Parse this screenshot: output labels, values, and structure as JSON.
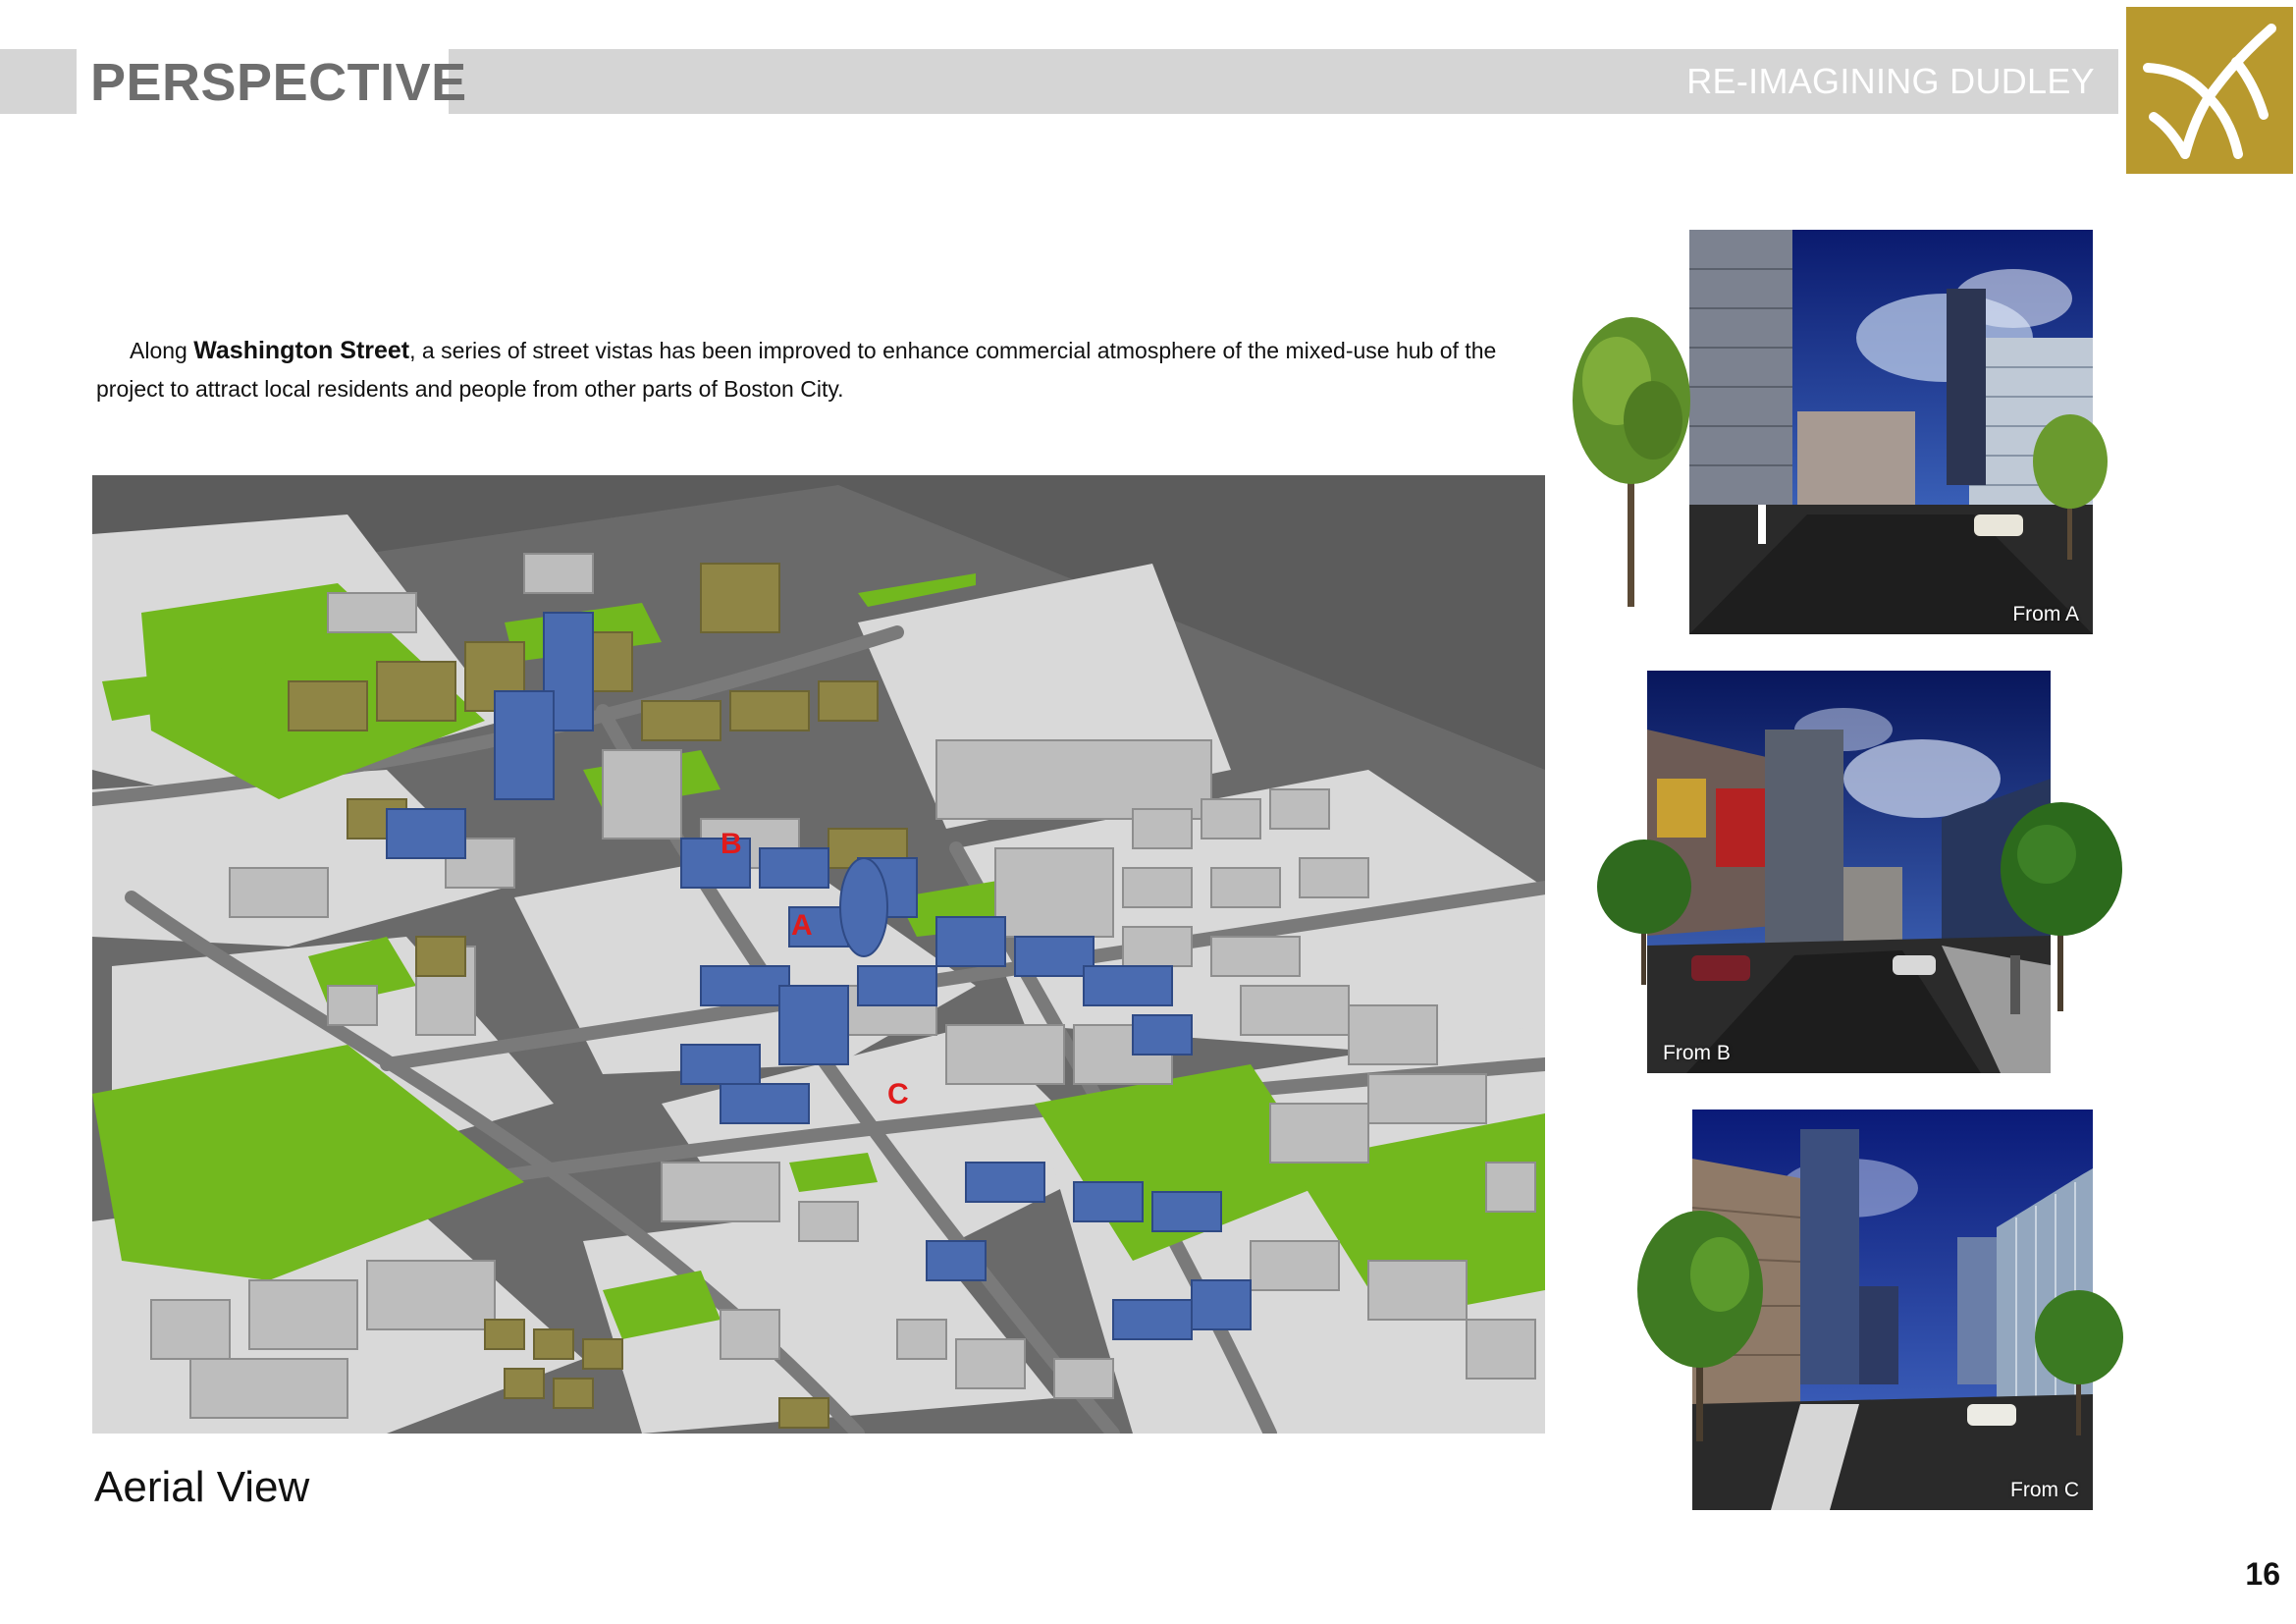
{
  "header": {
    "section_title": "PERSPECTIVE",
    "project_title": "RE-IMAGINING DUDLEY",
    "logo_icon": "dudley-intersection-logo-icon"
  },
  "intro": {
    "lead": "Along ",
    "street": "Washington Street",
    "rest": ", a series of street vistas has been improved to enhance commercial atmosphere of the mixed-use hub of the project to attract local residents and people from other parts of Boston City."
  },
  "aerial": {
    "caption": "Aerial View",
    "markers": [
      "B",
      "A",
      "C"
    ]
  },
  "views": [
    {
      "label": "From A"
    },
    {
      "label": "From B"
    },
    {
      "label": "From C"
    }
  ],
  "page_number": "16",
  "colors": {
    "header_band": "#d5d5d5",
    "section_title": "#6e6e6e",
    "logo_bg": "#b8992e",
    "proposed_building": "#4a6bb0",
    "existing_building": "#b9b9b9",
    "residential_building": "#8f8545",
    "green_space": "#72b81e",
    "marker": "#e01b1b"
  }
}
